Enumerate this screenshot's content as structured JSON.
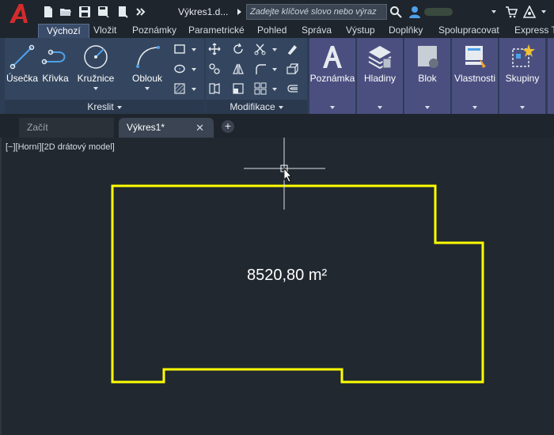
{
  "title_bar": {
    "document_title": "Výkres1.d...",
    "search_placeholder": "Zadejte klíčové slovo nebo výraz",
    "icons": [
      "autocad-logo",
      "new-file-icon",
      "open-folder-icon",
      "save-icon",
      "save-as-icon",
      "plot-icon",
      "more-icon",
      "search-icon",
      "user-icon",
      "cart-icon",
      "share-icon"
    ]
  },
  "ribbon_tabs": [
    {
      "label": "Výchozí",
      "active": true
    },
    {
      "label": "Vložit"
    },
    {
      "label": "Poznámky"
    },
    {
      "label": "Parametrické"
    },
    {
      "label": "Pohled"
    },
    {
      "label": "Správa"
    },
    {
      "label": "Výstup"
    },
    {
      "label": "Doplňky"
    },
    {
      "label": "Spolupracovat"
    },
    {
      "label": "Express To"
    }
  ],
  "panels": {
    "draw": {
      "footer": "Kreslit",
      "tools": [
        "Úsečka",
        "Křivka",
        "Kružnice",
        "Oblouk"
      ]
    },
    "modify": {
      "footer": "Modifikace"
    }
  },
  "large_buttons": [
    "Poznámka",
    "Hladiny",
    "Blok",
    "Vlastnosti",
    "Skupiny"
  ],
  "file_tabs": {
    "start": "Začít",
    "document": "Výkres1*",
    "close_glyph": "✕",
    "new_glyph": "+"
  },
  "viewport": {
    "label": "[−][Horní][2D drátový model]",
    "area_text": "8520,80 m²"
  },
  "colors": {
    "accent_polyline": "#ffff00",
    "ribbon_bg": "#2d3d55",
    "purple_buttons": "#4b4f80",
    "logo_red": "#d42b2b"
  }
}
